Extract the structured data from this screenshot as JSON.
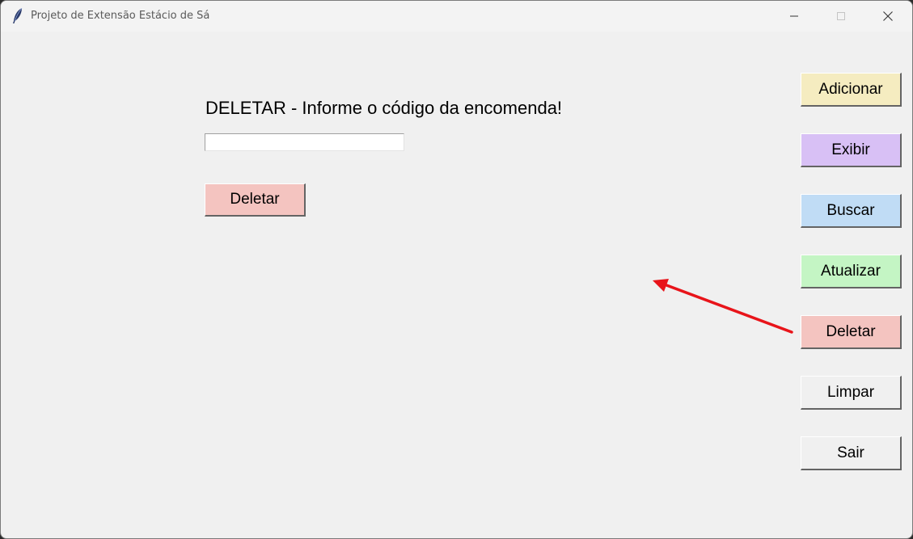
{
  "window": {
    "title": "Projeto de Extensão Estácio de Sá"
  },
  "form": {
    "heading": "DELETAR - Informe o código da encomenda!",
    "code_value": "",
    "code_placeholder": "",
    "delete_label": "Deletar",
    "delete_color": "#f4c4c0"
  },
  "sidebar": {
    "buttons": [
      {
        "label": "Adicionar",
        "color": "#f5ecc0"
      },
      {
        "label": "Exibir",
        "color": "#d8c0f5"
      },
      {
        "label": "Buscar",
        "color": "#c0dcf5"
      },
      {
        "label": "Atualizar",
        "color": "#c4f5c4"
      },
      {
        "label": "Deletar",
        "color": "#f4c4c0"
      },
      {
        "label": "Limpar",
        "color": "#f0f0f0"
      },
      {
        "label": "Sair",
        "color": "#f0f0f0"
      }
    ]
  },
  "annotation": {
    "arrow_color": "#e8141a"
  }
}
